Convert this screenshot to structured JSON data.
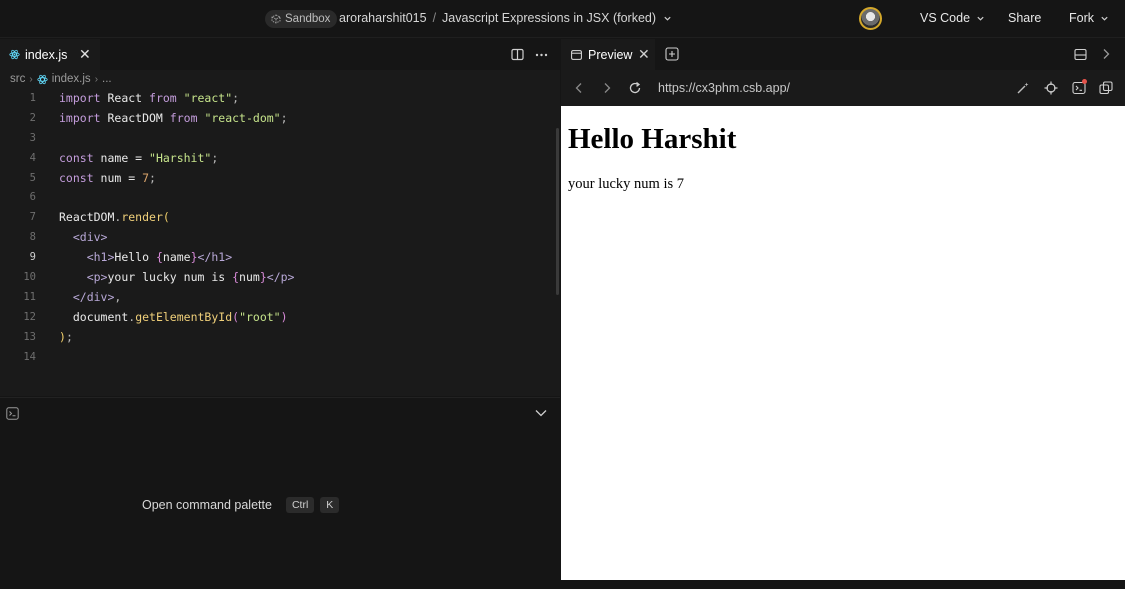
{
  "topbar": {
    "sandbox_label": "Sandbox",
    "owner": "aroraharshit015",
    "separator": "/",
    "project_title": "Javascript Expressions in JSX (forked)",
    "vscode_label": "VS Code",
    "share_label": "Share",
    "fork_label": "Fork"
  },
  "editor": {
    "tab_label": "index.js",
    "breadcrumbs": [
      "src",
      "index.js",
      "..."
    ],
    "active_line": 9,
    "lines": [
      {
        "n": "1"
      },
      {
        "n": "2"
      },
      {
        "n": "3"
      },
      {
        "n": "4"
      },
      {
        "n": "5"
      },
      {
        "n": "6"
      },
      {
        "n": "7"
      },
      {
        "n": "8"
      },
      {
        "n": "9"
      },
      {
        "n": "10"
      },
      {
        "n": "11"
      },
      {
        "n": "12"
      },
      {
        "n": "13"
      },
      {
        "n": "14"
      }
    ],
    "code": {
      "l1": [
        "import",
        " React ",
        "from",
        " ",
        "\"react\"",
        ";"
      ],
      "l2": [
        "import",
        " ReactDOM ",
        "from",
        " ",
        "\"react-dom\"",
        ";"
      ],
      "l4": [
        "const",
        " name = ",
        "\"Harshit\"",
        ";"
      ],
      "l5": [
        "const",
        " num = ",
        "7",
        ";"
      ],
      "l7": [
        "ReactDOM",
        ".",
        "render",
        "("
      ],
      "l8": [
        "<div>"
      ],
      "l9": [
        "<h1>",
        "Hello ",
        "{",
        "name",
        "}",
        "</h1>"
      ],
      "l10": [
        "<p>",
        "your lucky num is ",
        "{",
        "num",
        "}",
        "</p>"
      ],
      "l11": [
        "</div>",
        ","
      ],
      "l12": [
        "document",
        ".",
        "getElementById",
        "(",
        "\"root\"",
        ")"
      ],
      "l13": [
        ")",
        ";"
      ]
    }
  },
  "terminal": {
    "hint_label": "Open command palette",
    "key1": "Ctrl",
    "key2": "K"
  },
  "preview": {
    "tab_label": "Preview",
    "url": "https://cx3phm.csb.app/",
    "page_heading": "Hello Harshit",
    "page_text": "your lucky num is 7"
  },
  "colors": {
    "background": "#151515",
    "editor_bg": "#1a1a1a",
    "keyword": "#c49ddc",
    "string": "#c6e48b",
    "number": "#d9a46b",
    "function": "#f0d07a",
    "avatar_ring": "#d4a82a"
  }
}
